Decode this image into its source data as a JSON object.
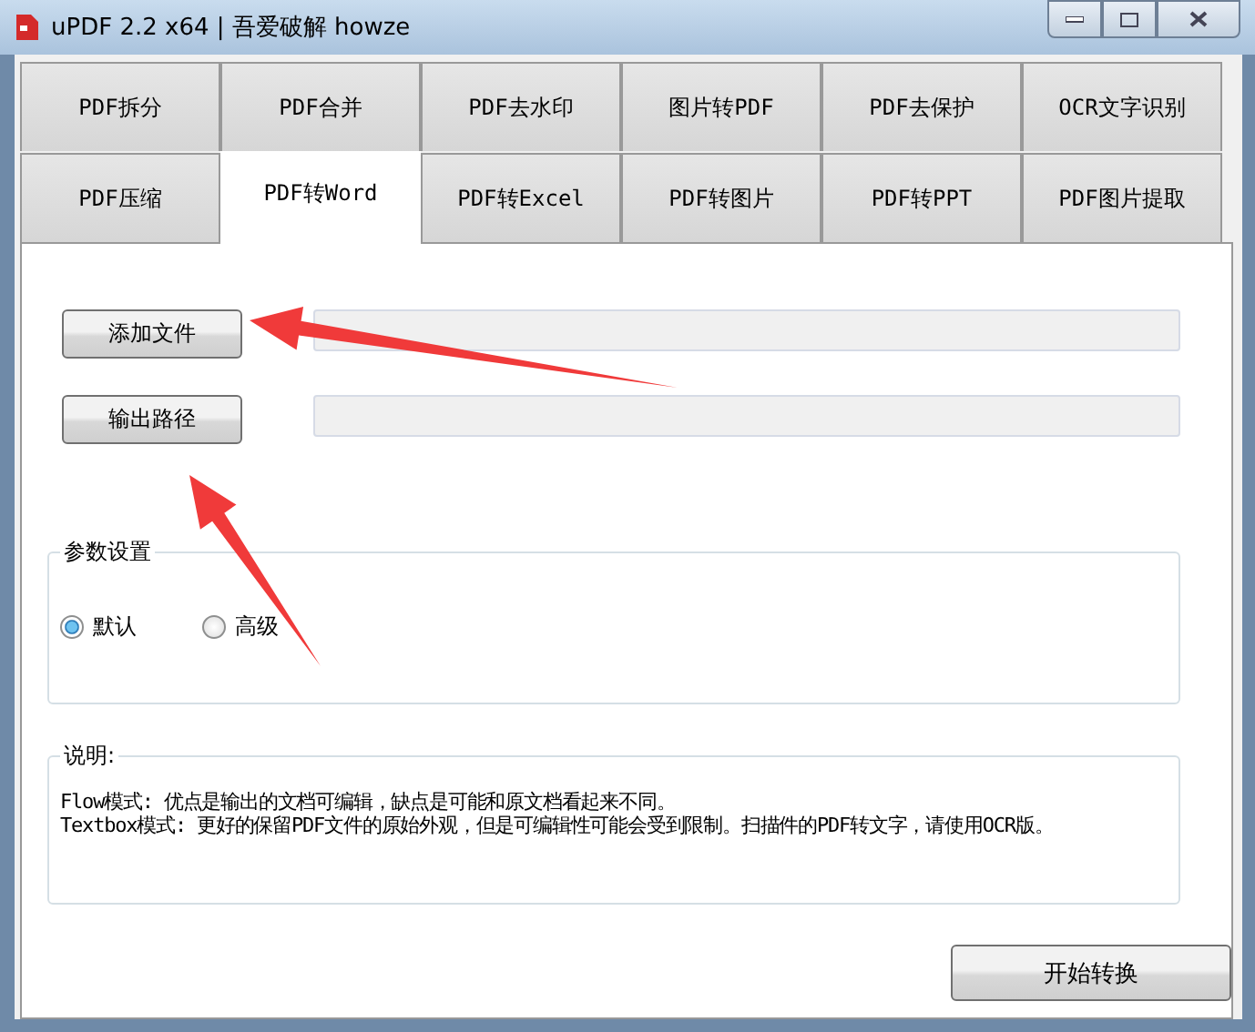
{
  "window": {
    "title": "uPDF 2.2 x64 | 吾爱破解 howze"
  },
  "tab_rows": [
    [
      {
        "label": "PDF拆分",
        "selected": false
      },
      {
        "label": "PDF合并",
        "selected": false
      },
      {
        "label": "PDF去水印",
        "selected": false
      },
      {
        "label": "图片转PDF",
        "selected": false
      },
      {
        "label": "PDF去保护",
        "selected": false
      },
      {
        "label": "OCR文字识别",
        "selected": false
      }
    ],
    [
      {
        "label": "PDF压缩",
        "selected": false
      },
      {
        "label": "PDF转Word",
        "selected": true
      },
      {
        "label": "PDF转Excel",
        "selected": false
      },
      {
        "label": "PDF转图片",
        "selected": false
      },
      {
        "label": "PDF转PPT",
        "selected": false
      },
      {
        "label": "PDF图片提取",
        "selected": false
      }
    ]
  ],
  "file_rows": [
    {
      "button": "添加文件"
    },
    {
      "button": "输出路径"
    }
  ],
  "settings": {
    "title": "参数设置",
    "options": [
      {
        "label": "默认",
        "selected": true
      },
      {
        "label": "高级",
        "selected": false
      }
    ]
  },
  "notes": {
    "title": "说明:",
    "lines": [
      "Flow模式: 优点是输出的文档可编辑，缺点是可能和原文档看起来不同。",
      "Textbox模式: 更好的保留PDF文件的原始外观，但是可编辑性可能会受到限制。扫描件的PDF转文字，请使用OCR版。"
    ]
  },
  "start_button": "开始转换"
}
